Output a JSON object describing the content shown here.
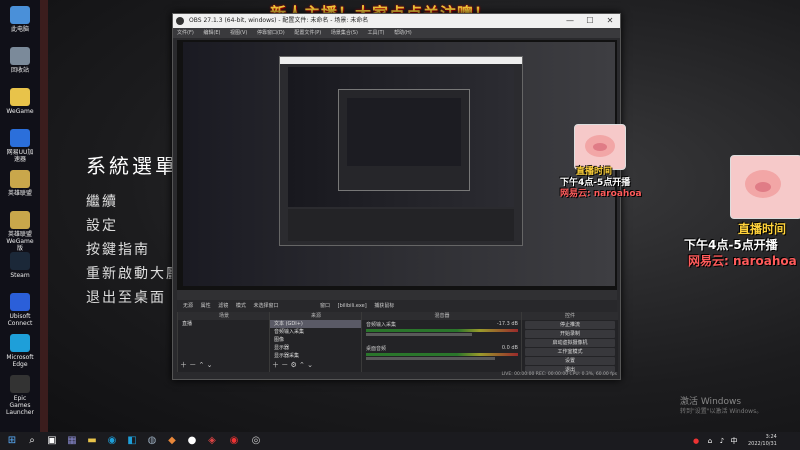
{
  "top_caption": "新人主播！大家点点关注噢！",
  "desktop": {
    "icons": [
      {
        "label": "此电脑",
        "color": "#4a90d9"
      },
      {
        "label": "回收站",
        "color": "#7b8a9a"
      },
      {
        "label": "WeGame",
        "color": "#e8c34a"
      },
      {
        "label": "网易UU加速器",
        "color": "#2b6fdb"
      },
      {
        "label": "英雄联盟",
        "color": "#c9a74b"
      },
      {
        "label": "英雄联盟WeGame版",
        "color": "#c9a74b"
      },
      {
        "label": "Steam",
        "color": "#1b2838"
      },
      {
        "label": "Ubisoft Connect",
        "color": "#2b5fd9"
      },
      {
        "label": "Microsoft Edge",
        "color": "#1e9fd9"
      },
      {
        "label": "Epic Games Launcher",
        "color": "#333333"
      }
    ]
  },
  "game_menu": {
    "title": "系統選單",
    "items": [
      "繼續",
      "設定",
      "按鍵指南",
      "重新啟動大廳",
      "退出至桌面"
    ]
  },
  "obs": {
    "title": "OBS 27.1.3 (64-bit, windows) - 配置文件: 未命名 - 场景: 未命名",
    "menu": [
      "文件(F)",
      "编辑(E)",
      "视图(V)",
      "停靠窗口(D)",
      "配置文件(P)",
      "场景集合(S)",
      "工具(T)",
      "帮助(H)"
    ],
    "dock_bar": [
      "无源",
      "属性",
      "滤镜",
      "模式",
      "未选择窗口",
      "窗口",
      "[bilibili.exe]",
      "捕获鼠标"
    ],
    "scenes": {
      "header": "场景",
      "items": [
        "直播"
      ]
    },
    "sources": {
      "header": "来源",
      "items": [
        "文本 (GDI+)",
        "音频输入采集",
        "图像",
        "显示器",
        "显示器采集"
      ]
    },
    "mixer": {
      "header": "混音器",
      "channels": [
        {
          "name": "音频输入采集",
          "db": "-17.3 dB"
        },
        {
          "name": "桌面音频",
          "db": "0.0 dB"
        }
      ]
    },
    "controls": {
      "header": "控件",
      "buttons": [
        "停止推流",
        "开始录制",
        "启动虚拟摄像机",
        "工作室模式",
        "设置",
        "退出"
      ]
    },
    "status": "LIVE: 00:00:00   REC: 00:00:00   CPU: 0.3%, 60.00 fps"
  },
  "overlay": {
    "text1": "直播时间",
    "text2": "下午4点-5点开播",
    "text3": "网易云: naroahoa"
  },
  "watermark": {
    "line1": "激活 Windows",
    "line2": "转到\"设置\"以激活 Windows。"
  },
  "taskbar": {
    "time": "3:24",
    "date": "2022/10/31",
    "lang": "中"
  }
}
